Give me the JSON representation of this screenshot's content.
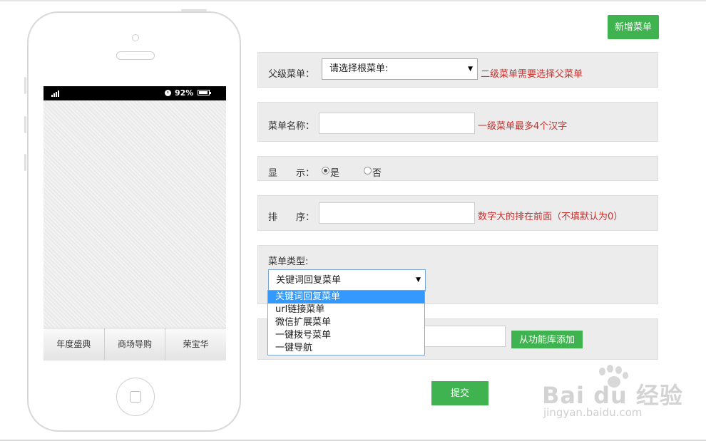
{
  "phone": {
    "status_bar": {
      "battery_percent": "92%"
    },
    "bottom_menu": [
      "年度盛典",
      "商场导购",
      "荣宝华"
    ]
  },
  "toolbar": {
    "add_menu_label": "新增菜单"
  },
  "form": {
    "parent_menu": {
      "label": "父级菜单：",
      "select_value": "请选择根菜单:",
      "hint": "二级菜单需要选择父菜单"
    },
    "menu_name": {
      "label": "菜单名称：",
      "value": "",
      "hint": "一级菜单最多4个汉字"
    },
    "display": {
      "label": "显　　示：",
      "options": [
        "是",
        "否"
      ],
      "selected": "是"
    },
    "sort": {
      "label": "排　　序：",
      "value": "",
      "hint": "数字大的排在前面（不填默认为0）"
    },
    "menu_type": {
      "label": "菜单类型:",
      "select_value": "关键词回复菜单",
      "options": [
        "关键词回复菜单",
        "url链接菜单",
        "微信扩展菜单",
        "一键拨号菜单",
        "一键导航"
      ],
      "selected_index": 0
    },
    "library": {
      "value": "",
      "add_button_label": "从功能库添加"
    },
    "submit_label": "提交"
  },
  "colors": {
    "accent_green": "#3fb34f",
    "hint_red": "#c9302c",
    "selection_blue": "#3399ff"
  },
  "watermark": {
    "logo": "Bai du 经验",
    "url": "jingyan.baidu.com"
  }
}
